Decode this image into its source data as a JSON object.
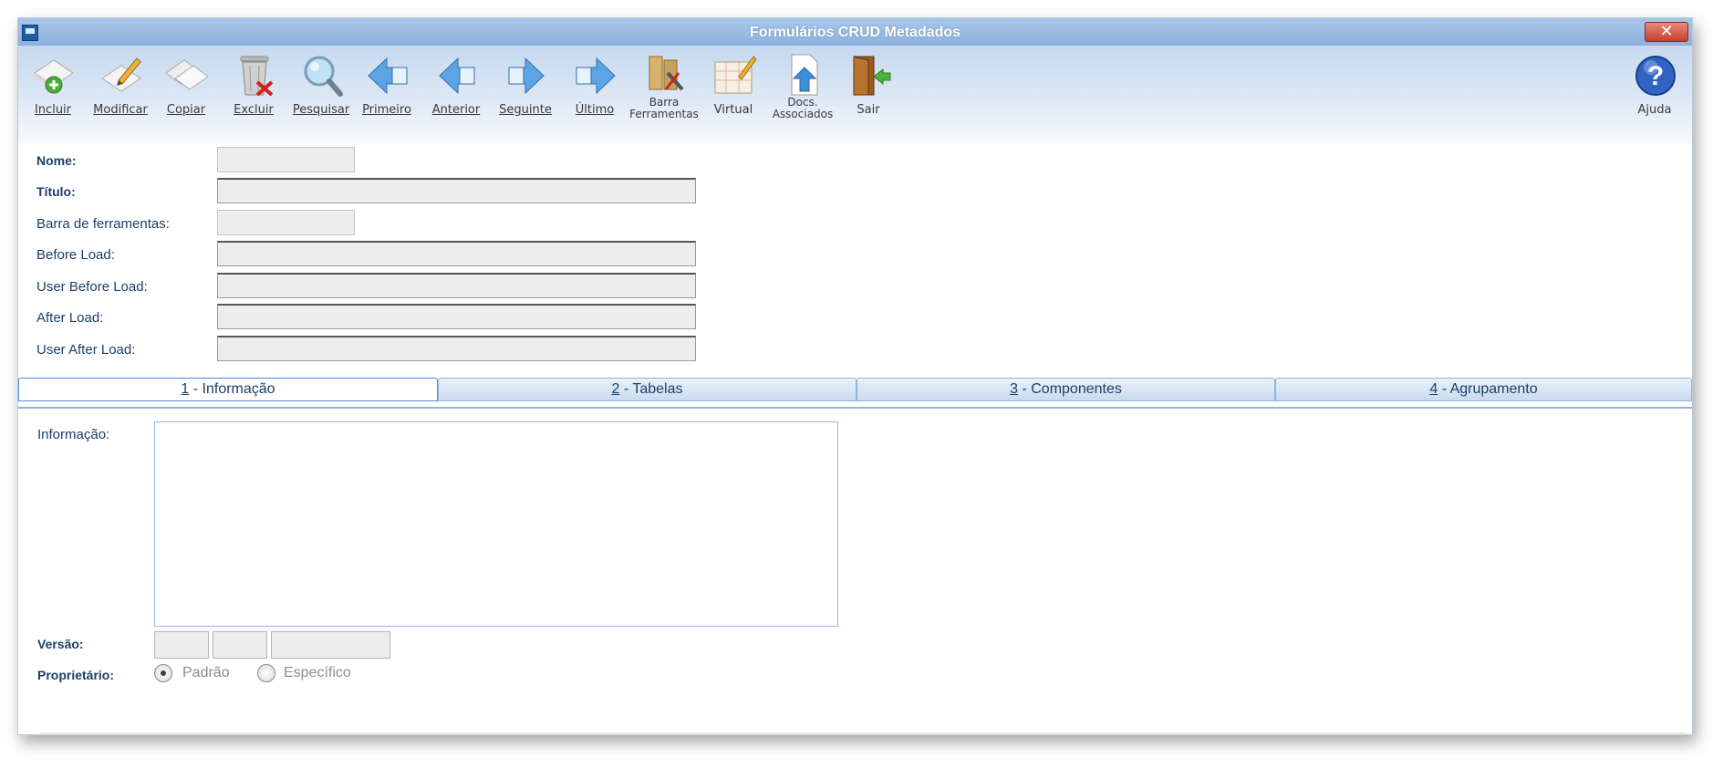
{
  "window": {
    "title": "Formulários CRUD Metadados",
    "close_glyph": "✕"
  },
  "toolbar": {
    "buttons": [
      {
        "label": "Incluir",
        "icon": "add-icon"
      },
      {
        "label": "Modificar",
        "icon": "edit-icon"
      },
      {
        "label": "Copiar",
        "icon": "copy-icon"
      },
      {
        "label": "Excluir",
        "icon": "trash-icon"
      },
      {
        "label": "Pesquisar",
        "icon": "search-icon"
      },
      {
        "label": "Primeiro",
        "icon": "first-icon"
      },
      {
        "label": "Anterior",
        "icon": "previous-icon"
      },
      {
        "label": "Seguinte",
        "icon": "next-icon"
      },
      {
        "label": "Último",
        "icon": "last-icon"
      },
      {
        "label_line1": "Barra",
        "label_line2": "Ferramentas",
        "icon": "tools-icon"
      },
      {
        "label": "Virtual",
        "icon": "virtual-icon"
      },
      {
        "label_line1": "Docs.",
        "label_line2": "Associados",
        "icon": "upload-document-icon"
      },
      {
        "label": "Sair",
        "icon": "exit-icon"
      }
    ],
    "help": {
      "label": "Ajuda",
      "icon": "help-icon",
      "glyph": "?"
    }
  },
  "form": {
    "fields": [
      {
        "label": "Nome:"
      },
      {
        "label": "Título:"
      },
      {
        "label": "Barra de ferramentas:"
      },
      {
        "label": "Before Load:"
      },
      {
        "label": "User Before Load:"
      },
      {
        "label": "After Load:"
      },
      {
        "label": "User After Load:"
      }
    ]
  },
  "tabs": [
    {
      "num": "1",
      "label": " - Informação"
    },
    {
      "num": "2",
      "label": " - Tabelas"
    },
    {
      "num": "3",
      "label": " - Componentes"
    },
    {
      "num": "4",
      "label": " - Agrupamento"
    }
  ],
  "info_tab": {
    "info_label": "Informação:",
    "version_label": "Versão:",
    "owner_label": "Proprietário:",
    "owner_options": [
      {
        "label": "Padrão",
        "selected": true
      },
      {
        "label": "Específico",
        "selected": false
      }
    ]
  },
  "colors": {
    "accent": "#1c3f67",
    "title_bar": "#9bbde6",
    "close": "#c5402b"
  }
}
